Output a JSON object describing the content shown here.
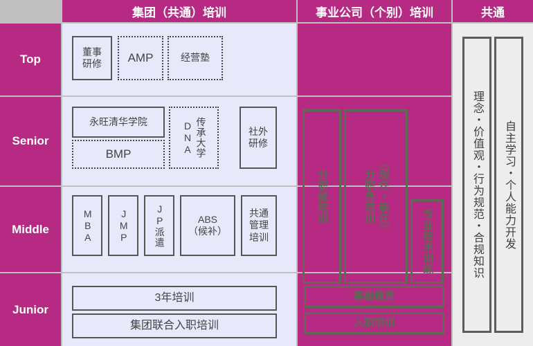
{
  "header": {
    "corner_label": "",
    "columns": [
      {
        "id": "group",
        "label": "集团（共通）培训"
      },
      {
        "id": "biz",
        "label": "事业公司（个别）培训"
      },
      {
        "id": "common",
        "label": "共通"
      }
    ]
  },
  "colors": {
    "brand_magenta": "#b62a84",
    "panel_lavender": "#e7e8fa",
    "panel_gray": "#ededed",
    "divider_gray": "#c0c0c0",
    "box_border": "#555555",
    "magenta_box_border": "#5d6b55"
  },
  "rows": [
    {
      "id": "top",
      "label": "Top"
    },
    {
      "id": "senior",
      "label": "Senior"
    },
    {
      "id": "middle",
      "label": "Middle"
    },
    {
      "id": "junior",
      "label": "Junior"
    }
  ],
  "group_training": {
    "top": [
      {
        "label": "董事\n研修",
        "style": "solid"
      },
      {
        "label": "AMP",
        "style": "dotted"
      },
      {
        "label": "经营塾",
        "style": "dotted"
      }
    ],
    "senior": [
      {
        "label": "永旺清华学院",
        "style": "solid"
      },
      {
        "label": "BMP",
        "style": "dotted"
      },
      {
        "label_a": "传承大学",
        "label_b": "DNA",
        "style": "dotted",
        "orientation": "vertical"
      },
      {
        "label": "社外\n研修",
        "style": "solid"
      }
    ],
    "middle": [
      {
        "label": "MBA",
        "style": "solid",
        "orientation": "vertical-letters"
      },
      {
        "label": "JMP",
        "style": "solid",
        "orientation": "vertical-letters"
      },
      {
        "label": "JP派遣",
        "style": "solid",
        "orientation": "vertical-letters"
      },
      {
        "label": "ABS\n（候补）",
        "style": "solid"
      },
      {
        "label": "共通\n管理\n培训",
        "style": "solid"
      }
    ],
    "junior": [
      {
        "label": "3年培训",
        "style": "solid"
      },
      {
        "label": "集团联合入职培训",
        "style": "solid"
      }
    ]
  },
  "business_training": {
    "top": [],
    "spanning": [
      {
        "label": "分职级培训",
        "orientation": "vertical"
      },
      {
        "label_a": "（现任・新任）",
        "label_b": "分职务培训",
        "orientation": "vertical"
      },
      {
        "label": "专业技术训练",
        "orientation": "vertical"
      }
    ],
    "junior": [
      {
        "label": "基础教育"
      },
      {
        "label": "入职培训"
      }
    ]
  },
  "common_column": [
    {
      "label": "理念・价值观・行为规范・合规知识",
      "orientation": "vertical"
    },
    {
      "label": "自主学习・个人能力开发",
      "orientation": "vertical"
    }
  ]
}
